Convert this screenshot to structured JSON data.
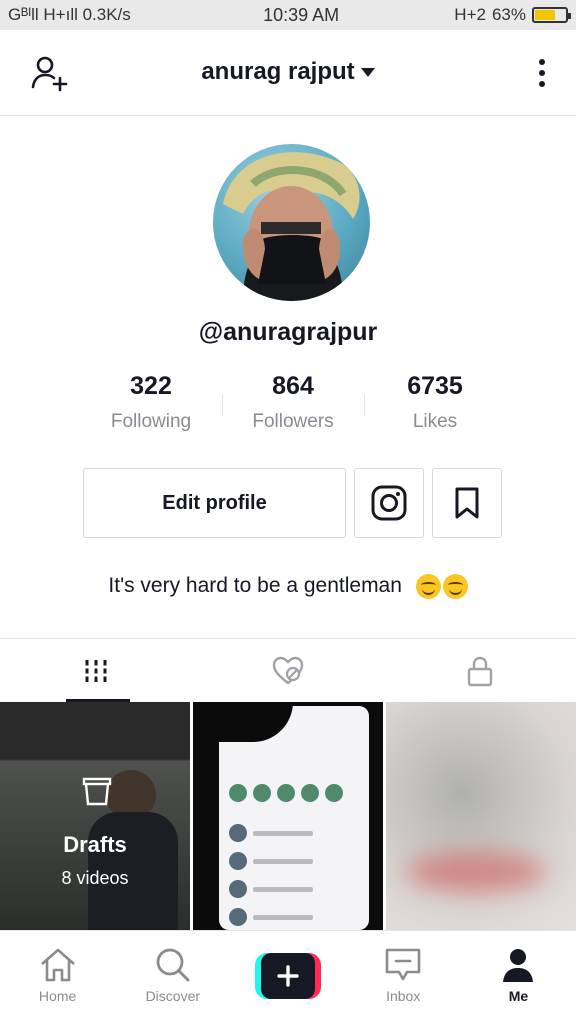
{
  "status_bar": {
    "left": "Gᴮᴵll H+ıll 0.3K/s",
    "time": "10:39 AM",
    "network_right": "H+2",
    "battery": "63%",
    "battery_level": 0.63
  },
  "header": {
    "username": "anurag rajput"
  },
  "profile": {
    "handle": "@anuragrajpur",
    "stats": [
      {
        "value": "322",
        "label": "Following"
      },
      {
        "value": "864",
        "label": "Followers"
      },
      {
        "value": "6735",
        "label": "Likes"
      }
    ],
    "edit_label": "Edit profile",
    "bio": "It's very hard to be a gentleman"
  },
  "tabs": [
    "videos-grid",
    "liked-hidden",
    "private-lock"
  ],
  "drafts": {
    "title": "Drafts",
    "count": "8 videos"
  },
  "nav": [
    {
      "label": "Home",
      "icon": "home-icon"
    },
    {
      "label": "Discover",
      "icon": "search-icon"
    },
    {
      "label": "",
      "icon": "plus-icon"
    },
    {
      "label": "Inbox",
      "icon": "inbox-icon"
    },
    {
      "label": "Me",
      "icon": "person-icon"
    }
  ],
  "colors": {
    "accent_cyan": "#25f4ee",
    "accent_red": "#fe2c55",
    "text_primary": "#161823",
    "text_secondary": "#8a8b91"
  }
}
